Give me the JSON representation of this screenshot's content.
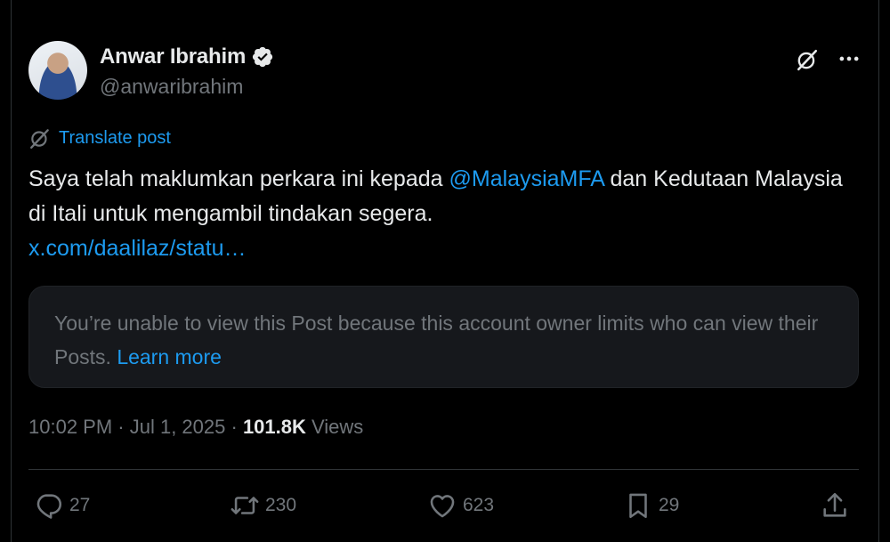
{
  "author": {
    "name": "Anwar Ibrahim",
    "handle": "@anwaribrahim",
    "verified": true
  },
  "translate_label": "Translate post",
  "tweet": {
    "text_before": "Saya telah maklumkan perkara ini kepada ",
    "mention": "@MalaysiaMFA",
    "text_after": " dan Kedutaan Malaysia di Itali untuk mengambil tindakan segera.",
    "link": "x.com/daalilaz/statu…"
  },
  "quote_notice": {
    "text": "You’re unable to view this Post because this account owner limits who can view their Posts. ",
    "learn_more": "Learn more"
  },
  "meta": {
    "time": "10:02 PM",
    "separator": " · ",
    "date": "Jul 1, 2025",
    "views_count": "101.8K",
    "views_label": " Views"
  },
  "actions": {
    "replies": "27",
    "reposts": "230",
    "likes": "623",
    "bookmarks": "29"
  },
  "colors": {
    "background": "#000000",
    "link": "#1d9bf0",
    "secondary_text": "#71767b",
    "primary_text": "#e7e9ea",
    "card_background": "#16181c"
  },
  "icons": [
    "verified-badge-icon",
    "grok-icon",
    "more-icon",
    "translate-icon",
    "reply-icon",
    "repost-icon",
    "like-icon",
    "bookmark-icon",
    "share-icon"
  ]
}
